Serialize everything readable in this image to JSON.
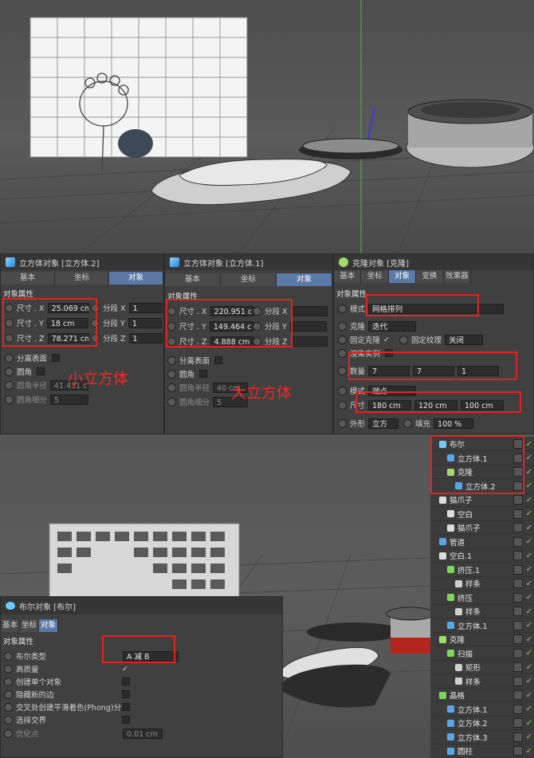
{
  "panel_cube_small": {
    "title": "立方体对象 [立方体.2]",
    "tabs": [
      "基本",
      "坐标",
      "对象"
    ],
    "section": "对象属性",
    "size_x_label": "尺寸 . X",
    "size_x": "25.069 cm",
    "size_y_label": "尺寸 . Y",
    "size_y": "18 cm",
    "size_z_label": "尺寸 . Z",
    "size_z": "78.271 cm",
    "seg_x_label": "分段 X",
    "seg_x": "1",
    "seg_y_label": "分段 Y",
    "seg_y": "1",
    "seg_z_label": "分段 Z",
    "seg_z": "1",
    "separate_surfaces": "分离表面",
    "fillet": "圆角",
    "fillet_radius_label": "圆角半径",
    "fillet_radius": "41.431 cm",
    "fillet_subdiv_label": "圆角细分",
    "fillet_subdiv": "5"
  },
  "panel_cube_large": {
    "title": "立方体对象 [立方体.1]",
    "tabs": [
      "基本",
      "坐标",
      "对象"
    ],
    "section": "对象属性",
    "size_x_label": "尺寸 . X",
    "size_x": "220.951 c",
    "size_y_label": "尺寸 . Y",
    "size_y": "149.464 c",
    "size_z_label": "尺寸 . Z",
    "size_z": "4.888 cm",
    "seg_x_label": "分段 X",
    "seg_y_label": "分段 Y",
    "seg_z_label": "分段 Z",
    "separate_surfaces": "分离表面",
    "fillet": "圆角",
    "fillet_radius_label": "圆角半径",
    "fillet_radius": "40 cm",
    "fillet_subdiv_label": "圆角细分",
    "fillet_subdiv": "5"
  },
  "panel_cloner": {
    "title": "克隆对象 [克隆]",
    "tabs": [
      "基本",
      "坐标",
      "对象",
      "变换",
      "效果器"
    ],
    "section": "对象属性",
    "mode_label": "模式",
    "mode_value": "网格排列",
    "clones_label": "克隆",
    "clones_value": "迭代",
    "fixed_clone_label": "固定克隆",
    "fixed_texture_label": "固定纹理",
    "fixed_texture_value": "关闭",
    "render_instances_label": "渲染实例",
    "count_label": "数量",
    "count_x": "7",
    "count_y": "7",
    "count_z": "1",
    "mode2_label": "模式",
    "mode2_value": "端点",
    "size_label": "尺寸",
    "size_x": "180 cm",
    "size_y": "120 cm",
    "size_z": "100 cm",
    "shape_label": "外形",
    "shape_value": "立方",
    "fill_label": "填充",
    "fill_value": "100 %"
  },
  "panel_boole": {
    "title": "布尔对象 [布尔]",
    "tabs": [
      "基本",
      "坐标",
      "对象"
    ],
    "section": "对象属性",
    "rows": [
      {
        "label": "布尔类型",
        "value": "A 减 B"
      },
      {
        "label": "高质量",
        "value": "✓"
      },
      {
        "label": "创建单个对象",
        "value": ""
      },
      {
        "label": "隐藏新的边",
        "value": ""
      },
      {
        "label": "交叉处创建平滑着色(Phong)分割",
        "value": ""
      },
      {
        "label": "选择交界",
        "value": ""
      },
      {
        "label": "优化点",
        "value": "0.01 cm"
      }
    ]
  },
  "annotations": {
    "small_cube": "小立方体",
    "large_cube": "大立方体"
  },
  "object_manager": {
    "items": [
      {
        "name": "布尔",
        "icon": "boole-icon",
        "color": "#6ecbff"
      },
      {
        "name": "立方体.1",
        "icon": "cube-icon",
        "color": "#5aa7e8"
      },
      {
        "name": "克隆",
        "icon": "cloner-icon",
        "color": "#9fdc6a"
      },
      {
        "name": "立方体.2",
        "icon": "cube-icon",
        "color": "#5aa7e8"
      },
      {
        "name": "猫爪子",
        "icon": "null-icon",
        "color": "#dddddd"
      },
      {
        "name": "空白",
        "icon": "null-icon",
        "color": "#dddddd"
      },
      {
        "name": "猫爪子",
        "icon": "null-icon",
        "color": "#dddddd"
      },
      {
        "name": "管道",
        "icon": "tube-icon",
        "color": "#5aa7e8"
      },
      {
        "name": "空白.1",
        "icon": "null-icon",
        "color": "#dddddd"
      },
      {
        "name": "挤压.1",
        "icon": "extrude-icon",
        "color": "#7fd65a"
      },
      {
        "name": "样条",
        "icon": "spline-icon",
        "color": "#cfcfcf"
      },
      {
        "name": "挤压",
        "icon": "extrude-icon",
        "color": "#7fd65a"
      },
      {
        "name": "样条",
        "icon": "spline-icon",
        "color": "#cfcfcf"
      },
      {
        "name": "立方体.1",
        "icon": "cube-icon",
        "color": "#5aa7e8"
      },
      {
        "name": "克隆",
        "icon": "cloner-icon",
        "color": "#9fdc6a"
      },
      {
        "name": "扫描",
        "icon": "sweep-icon",
        "color": "#7fd65a"
      },
      {
        "name": "矩形",
        "icon": "spline-icon",
        "color": "#cfcfcf"
      },
      {
        "name": "样条",
        "icon": "spline-icon",
        "color": "#cfcfcf"
      },
      {
        "name": "晶格",
        "icon": "lattice-icon",
        "color": "#7fd65a"
      },
      {
        "name": "立方体.1",
        "icon": "cube-icon",
        "color": "#5aa7e8"
      },
      {
        "name": "立方体.2",
        "icon": "cube-icon",
        "color": "#5aa7e8"
      },
      {
        "name": "立方体.3",
        "icon": "cube-icon",
        "color": "#5aa7e8"
      },
      {
        "name": "圆柱",
        "icon": "cylinder-icon",
        "color": "#5aa7e8"
      }
    ]
  }
}
